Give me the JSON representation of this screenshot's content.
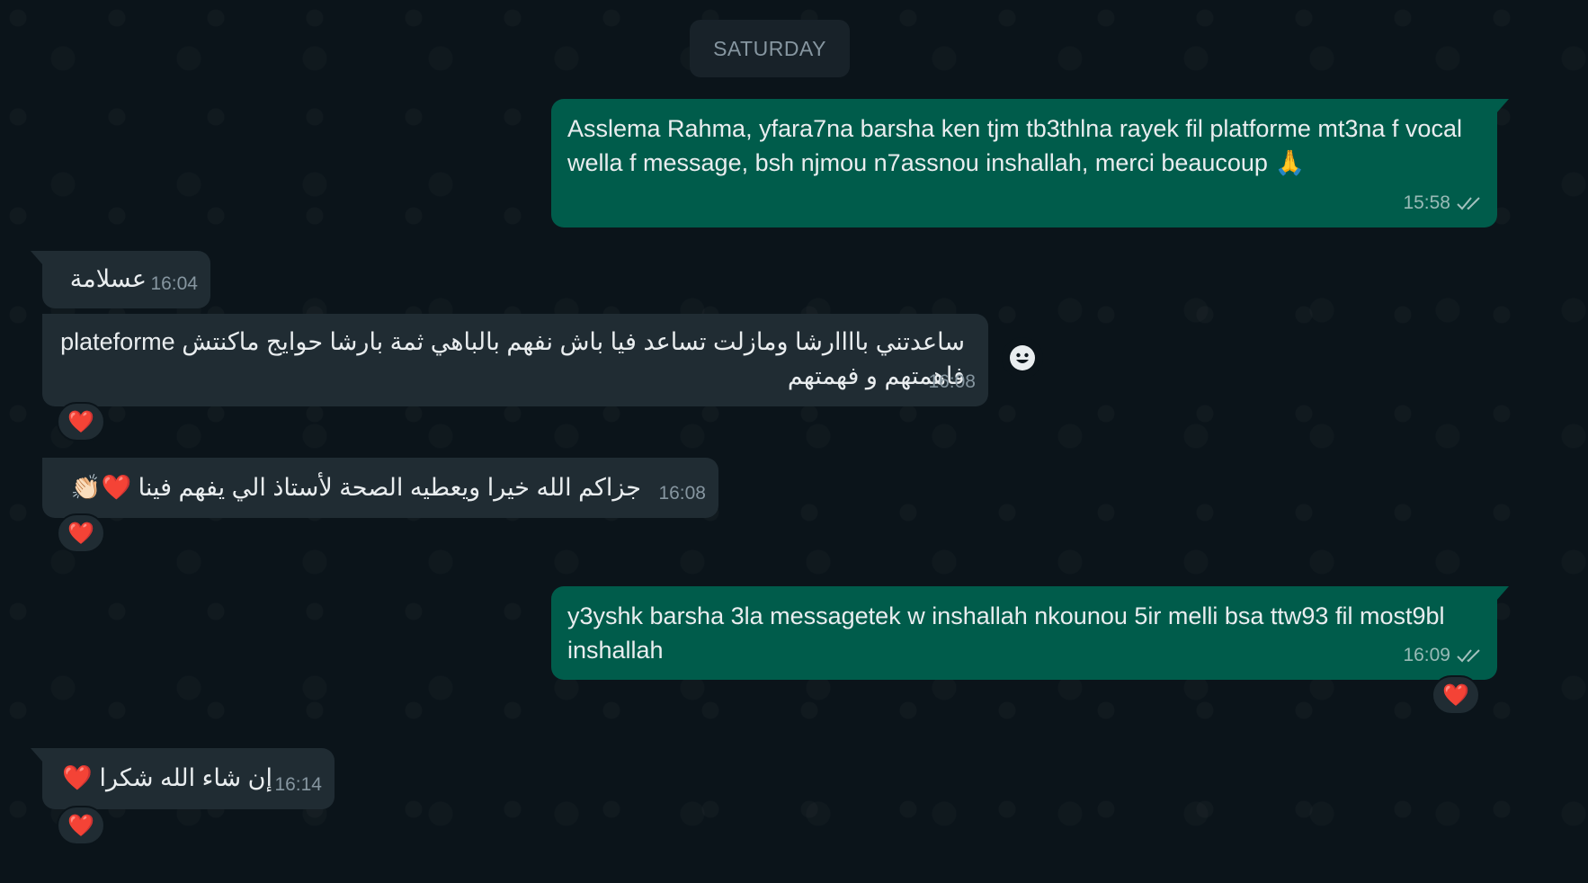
{
  "date_divider": "SATURDAY",
  "messages": [
    {
      "direction": "outgoing",
      "text": "Asslema Rahma, yfara7na barsha ken tjm tb3thlna rayek fil platforme mt3na f vocal wella f message, bsh njmou n7assnou inshallah, merci beaucoup 🙏",
      "time": "15:58",
      "status": "read-ticks"
    },
    {
      "direction": "incoming",
      "text": "عسلامة",
      "time": "16:04"
    },
    {
      "direction": "incoming",
      "text": "ساعدتني باااارشا ومازلت تساعد فيا باش نفهم بالباهي ثمة بارشا حوايج ماكنتش plateforme فاهمتهم و فهمتهم",
      "time": "16:08",
      "reaction": "❤️"
    },
    {
      "direction": "incoming",
      "text": "جزاكم الله خيرا ويعطيه الصحة لأستاذ الي يفهم فينا ❤️👏🏻",
      "time": "16:08",
      "reaction": "❤️"
    },
    {
      "direction": "outgoing",
      "text": "y3yshk barsha 3la messagetek w inshallah nkounou 5ir melli bsa ttw93 fil most9bl inshallah",
      "time": "16:09",
      "status": "read-ticks",
      "reaction": "❤️"
    },
    {
      "direction": "incoming",
      "text": "إن شاء الله شكرا ❤️",
      "time": "16:14",
      "reaction": "❤️"
    }
  ],
  "emoji_button_icon": "smiley-icon",
  "colors": {
    "background": "#0b141a",
    "outgoing_bubble": "#005c4b",
    "incoming_bubble": "#202c33",
    "timestamp": "#8696a0"
  }
}
